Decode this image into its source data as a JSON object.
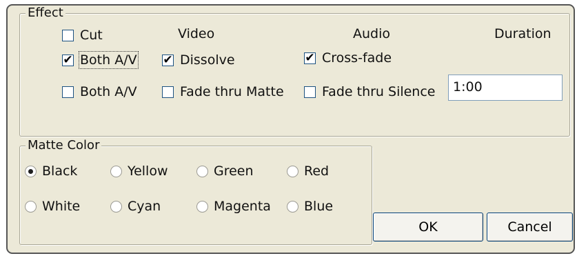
{
  "effect": {
    "title": "Effect",
    "headers": {
      "video": "Video",
      "audio": "Audio",
      "duration": "Duration"
    },
    "left_options": [
      {
        "label": "Cut",
        "checked": false
      },
      {
        "label": "Both A/V",
        "checked": true
      },
      {
        "label": "Both A/V",
        "checked": false
      }
    ],
    "video_options": [
      {
        "label": "Dissolve",
        "checked": true
      },
      {
        "label": "Fade thru Matte",
        "checked": false
      }
    ],
    "audio_options": [
      {
        "label": "Cross-fade",
        "checked": true
      },
      {
        "label": "Fade thru Silence",
        "checked": false
      }
    ],
    "duration_value": "1:00"
  },
  "matte": {
    "title": "Matte Color",
    "options": [
      "Black",
      "Yellow",
      "Green",
      "Red",
      "White",
      "Cyan",
      "Magenta",
      "Blue"
    ],
    "selected": "Black"
  },
  "buttons": {
    "ok": "OK",
    "cancel": "Cancel"
  },
  "colors": {
    "dialog_bg": "#ece9d8",
    "checkbox_border": "#1c5180",
    "button_border": "#003c74"
  }
}
